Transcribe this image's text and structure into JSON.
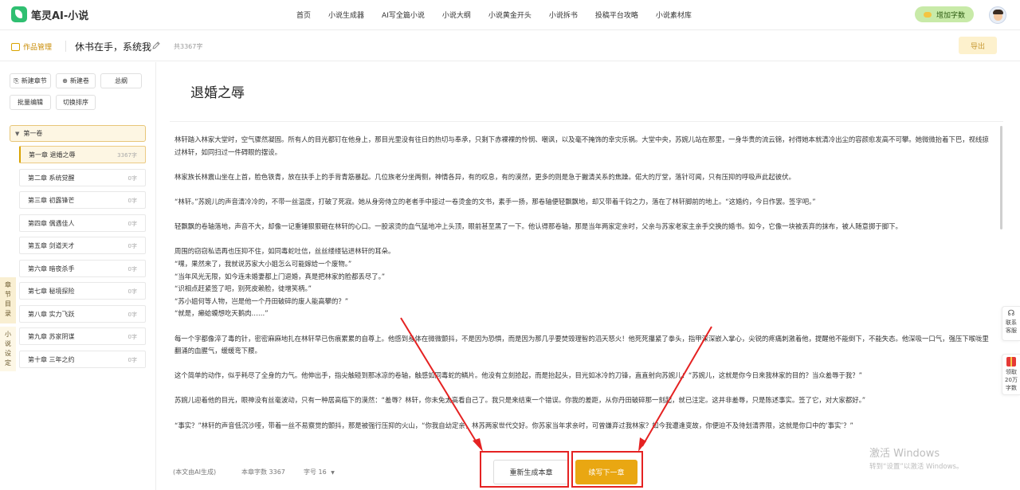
{
  "app": {
    "name": "笔灵AI-小说",
    "nav": [
      "首页",
      "小说生成器",
      "AI写全篇小说",
      "小说大纲",
      "小说黄金开头",
      "小说拆书",
      "投稿平台攻略",
      "小说素材库"
    ],
    "add_words_label": "增加字数"
  },
  "toolbar": {
    "works_label": "作品管理",
    "book_title": "休书在手，系统我有",
    "total_words": "共3367字",
    "export_label": "导出"
  },
  "sidebar": {
    "buttons": {
      "new_chapter": "新建章节",
      "new_volume": "新建卷",
      "outline": "总纲",
      "batch_edit": "批量编辑",
      "toggle_sort": "切换排序"
    },
    "volume": "第一卷",
    "chapters": [
      {
        "title": "第一章 退婚之辱",
        "count": "3367字"
      },
      {
        "title": "第二章 系统觉醒",
        "count": "0字"
      },
      {
        "title": "第三章 初露锋芒",
        "count": "0字"
      },
      {
        "title": "第四章 偶遇佳人",
        "count": "0字"
      },
      {
        "title": "第五章 剑道天才",
        "count": "0字"
      },
      {
        "title": "第六章 暗夜杀手",
        "count": "0字"
      },
      {
        "title": "第七章 秘境探险",
        "count": "0字"
      },
      {
        "title": "第八章 实力飞跃",
        "count": "0字"
      },
      {
        "title": "第九章 苏家阴谋",
        "count": "0字"
      },
      {
        "title": "第十章 三年之约",
        "count": "0字"
      }
    ],
    "tabs": {
      "directory": "章节目录",
      "settings": "小说设定"
    }
  },
  "editor": {
    "chapter_title": "退婚之辱",
    "paragraphs": [
      {
        "text": "林轩踏入林家大堂时，空气骤然凝固。所有人的目光都钉在他身上，那目光里没有往日的热切与奉承，只剩下赤裸裸的怜悯、嘲讽，以及毫不掩饰的幸灾乐祸。大堂中央，苏婉儿站在那里，一身华贵的流云锦，衬得她本就清冷出尘的容颜愈发高不可攀。她微微抬着下巴，视线掠过林轩，如同扫过一件碍眼的摆设。",
        "gap": true
      },
      {
        "text": "林家族长林震山坐在上首，脸色铁青，放在扶手上的手背青筋暴起。几位族老分坐两侧，神情各异，有的叹息，有的漠然，更多的则是急于撇清关系的焦躁。偌大的厅堂，落针可闻，只有压抑的呼吸声此起彼伏。",
        "gap": true
      },
      {
        "text": "“林轩。”苏婉儿的声音清冷冷的，不带一丝温度，打破了死寂。她从身旁侍立的老者手中接过一卷烫金的文书，素手一扬，那卷轴便轻飘飘地，却又带着千钧之力，落在了林轩脚前的地上。“这婚约，今日作罢。签字吧。”",
        "gap": true
      },
      {
        "text": "轻飘飘的卷轴落地，声音不大，却像一记重锤狠狠砸在林轩的心口。一股滚烫的血气猛地冲上头顶，眼前甚至黑了一下。他认得那卷轴，那是当年两家定亲时，父亲与苏家老家主亲手交换的婚书。如今，它像一块被丢弃的抹布，被人随意掷于脚下。",
        "gap": true
      },
      {
        "text": "周围的窃窃私语再也压抑不住，如同毒蛇吐信，丝丝缕缕钻进林轩的耳朵。",
        "gap": false
      },
      {
        "text": "“嘿，果然来了，我就说苏家大小姐怎么可能嫁给一个废物。”",
        "gap": false
      },
      {
        "text": "“当年风光无限，如今连未婚妻都上门退婚，真是把林家的脸都丢尽了。”",
        "gap": false
      },
      {
        "text": "“识相点赶紧签了吧，别死皮赖脸，徒增笑柄。”",
        "gap": false
      },
      {
        "text": "“苏小姐何等人物，岂是他一个丹田破碎的废人能高攀的？”",
        "gap": false
      },
      {
        "text": "“就是，癞蛤蟆想吃天鹅肉……”",
        "gap": true
      },
      {
        "text": "每一个字都像淬了毒的针，密密麻麻地扎在林轩早已伤痕累累的自尊上。他感到身体在微微颤抖，不是因为恐惧，而是因为那几乎要焚毁理智的滔天怒火！他死死攥紧了拳头，指甲深深嵌入掌心，尖锐的疼痛刺激着他，提醒他不能倒下，不能失态。他深吸一口气，强压下喉咙里翻涌的血腥气，缓缓弯下腰。",
        "gap": true
      },
      {
        "text": "这个简单的动作，似乎耗尽了全身的力气。他伸出手，指尖触碰到那冰凉的卷轴，触感如同毒蛇的鳞片。他没有立刻拾起，而是抬起头，目光如冰冷的刀锋，直直射向苏婉儿：“苏婉儿，这就是你今日来我林家的目的？当众羞辱于我？”",
        "gap": true
      },
      {
        "text": "苏婉儿迎着他的目光，眼神没有丝毫波动，只有一种居高临下的漠然：“羞辱？林轩，你未免太高看自己了。我只是来结束一个错误。你我的差距，从你丹田破碎那一刻起，就已注定。这并非羞辱，只是陈述事实。签了它，对大家都好。”",
        "gap": true
      },
      {
        "text": "“事实？”林轩的声音低沉沙哑，带着一丝不易察觉的颤抖，那是被强行压抑的火山，“你我自幼定亲，林苏两家世代交好。你苏家当年求亲时，可曾嫌弃过我林家？如今我遭逢变故，你便迫不及待划清界限，这就是你口中的‘事实’？”",
        "gap": false
      }
    ],
    "footer": {
      "ai_note": "(本文由AI生成)",
      "word_count": "本章字数 3367",
      "font_size": "字号 16"
    },
    "regenerate_label": "重新生成本章",
    "continue_label": "续写下一章"
  },
  "floating": {
    "contact": "联系客服",
    "gift": "领取20万字数"
  },
  "watermark": {
    "line1": "激活 Windows",
    "line2": "转到“设置”以激活 Windows。"
  },
  "colors": {
    "accent": "#e9a712",
    "highlight": "#e52222",
    "brand": "#2fbf71"
  }
}
